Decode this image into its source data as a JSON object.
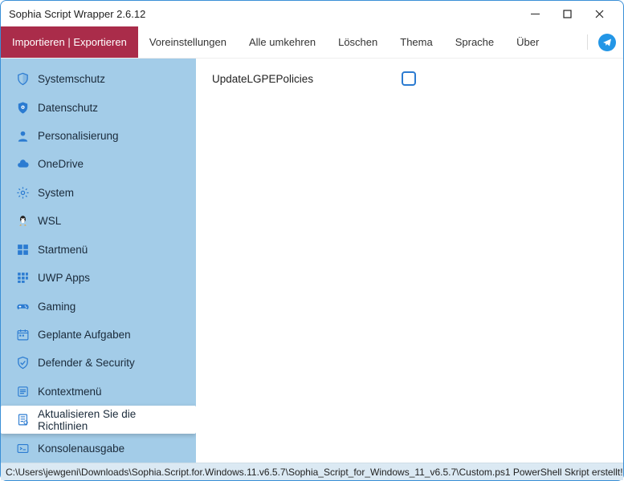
{
  "window": {
    "title": "Sophia Script Wrapper 2.6.12"
  },
  "menubar": {
    "primary": "Importieren | Exportieren",
    "items": [
      "Voreinstellungen",
      "Alle umkehren",
      "Löschen",
      "Thema",
      "Sprache",
      "Über"
    ]
  },
  "sidebar": {
    "items": [
      {
        "icon": "shield",
        "label": "Systemschutz"
      },
      {
        "icon": "eye-shield",
        "label": "Datenschutz"
      },
      {
        "icon": "person",
        "label": "Personalisierung"
      },
      {
        "icon": "cloud",
        "label": "OneDrive"
      },
      {
        "icon": "gear",
        "label": "System"
      },
      {
        "icon": "linux",
        "label": "WSL"
      },
      {
        "icon": "start",
        "label": "Startmenü"
      },
      {
        "icon": "grid",
        "label": "UWP Apps"
      },
      {
        "icon": "gamepad",
        "label": "Gaming"
      },
      {
        "icon": "calendar",
        "label": "Geplante Aufgaben"
      },
      {
        "icon": "defender",
        "label": "Defender & Security"
      },
      {
        "icon": "context",
        "label": "Kontextmenü"
      },
      {
        "icon": "policy",
        "label": "Aktualisieren Sie die Richtlinien"
      },
      {
        "icon": "console",
        "label": "Konsolenausgabe"
      }
    ],
    "active_index": 12
  },
  "content": {
    "settings": [
      {
        "label": "UpdateLGPEPolicies",
        "checked": false
      }
    ]
  },
  "statusbar": {
    "text": "C:\\Users\\jewgeni\\Downloads\\Sophia.Script.for.Windows.11.v6.5.7\\Sophia_Script_for_Windows_11_v6.5.7\\Custom.ps1 PowerShell Skript erstellt!"
  },
  "colors": {
    "accent": "#2b7bd1",
    "primary_btn": "#aa2c4a",
    "sidebar_bg": "#a3cce8",
    "status_bg": "#dbe9f3",
    "border": "#3a8fd6"
  }
}
